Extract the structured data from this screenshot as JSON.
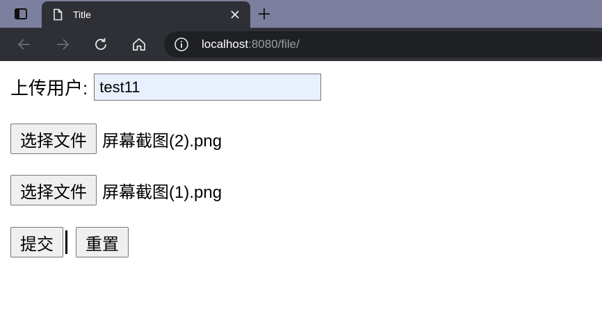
{
  "browser": {
    "tab_title": "Title",
    "url_host": "localhost",
    "url_rest": ":8080/file/"
  },
  "form": {
    "user_label": "上传用户:",
    "user_value": "test11",
    "file_rows": [
      {
        "button_label": "选择文件",
        "file_name": "屏幕截图(2).png"
      },
      {
        "button_label": "选择文件",
        "file_name": "屏幕截图(1).png"
      }
    ],
    "submit_label": "提交",
    "reset_label": "重置"
  },
  "colors": {
    "tab_bar": "#7c7f9d",
    "toolbar": "#2f3035",
    "autofill": "#e8f0fe"
  },
  "icons": [
    "tab-strip-icon",
    "page-icon",
    "close-icon",
    "new-tab-icon",
    "back-icon",
    "forward-icon",
    "reload-icon",
    "home-icon",
    "info-icon"
  ]
}
